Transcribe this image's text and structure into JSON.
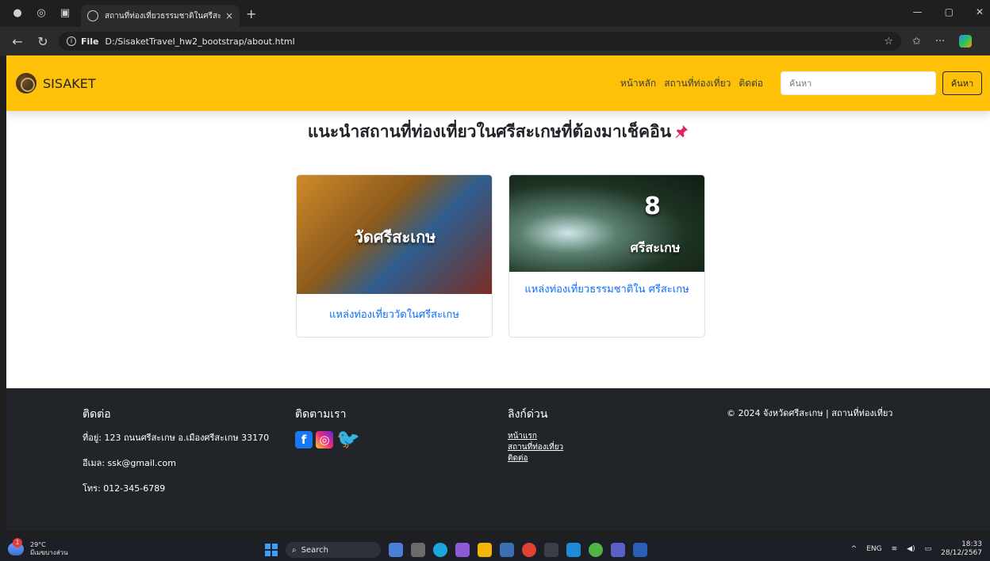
{
  "browser": {
    "tab_title": "สถานที่ท่องเที่ยวธรรมชาติในศรีสะเกษ",
    "tab_close": "×",
    "new_tab": "+",
    "url_scheme": "File",
    "url": "D:/SisaketTravel_hw2_bootstrap/about.html",
    "window_controls": [
      "—",
      "▢",
      "✕"
    ]
  },
  "navbar": {
    "brand": "SISAKET",
    "links": [
      "หน้าหลัก",
      "สถานที่ท่องเที่ยว",
      "ติดต่อ"
    ],
    "search_placeholder": "ค้นหา",
    "search_button": "ค้นหา",
    "color": "#ffc107"
  },
  "main": {
    "title": "แนะนำสถานที่ท่องเที่ยวในศรีสะเกษที่ต้องมาเช็คอิน",
    "cards": [
      {
        "image_text": "วัดศรีสะเกษ",
        "title": "แหล่งท่องเที่ยววัดในศรีสะเกษ"
      },
      {
        "image_number": "8",
        "image_text": "ศรีสะเกษ",
        "title": "แหล่งท่องเที่ยวธรรมชาติใน ศรีสะเกษ"
      }
    ]
  },
  "footer": {
    "contact": {
      "heading": "ติดต่อ",
      "address": "ที่อยู่: 123 ถนนศรีสะเกษ อ.เมืองศรีสะเกษ 33170",
      "email": "อีเมล: ssk@gmail.com",
      "phone": "โทร: 012-345-6789"
    },
    "follow": {
      "heading": "ติดตามเรา"
    },
    "links": {
      "heading": "ลิงก์ด่วน",
      "items": [
        "หน้าแรก",
        "สถานที่ท่องเที่ยว",
        "ติดต่อ"
      ]
    },
    "copyright": "© 2024 จังหวัดศรีสะเกษ | สถานที่ท่องเที่ยว"
  },
  "taskbar": {
    "temp": "29°C",
    "weather_desc": "มีเมฆบางส่วน",
    "search": "Search",
    "lang": "ENG",
    "time": "18:33",
    "date": "28/12/2567"
  }
}
